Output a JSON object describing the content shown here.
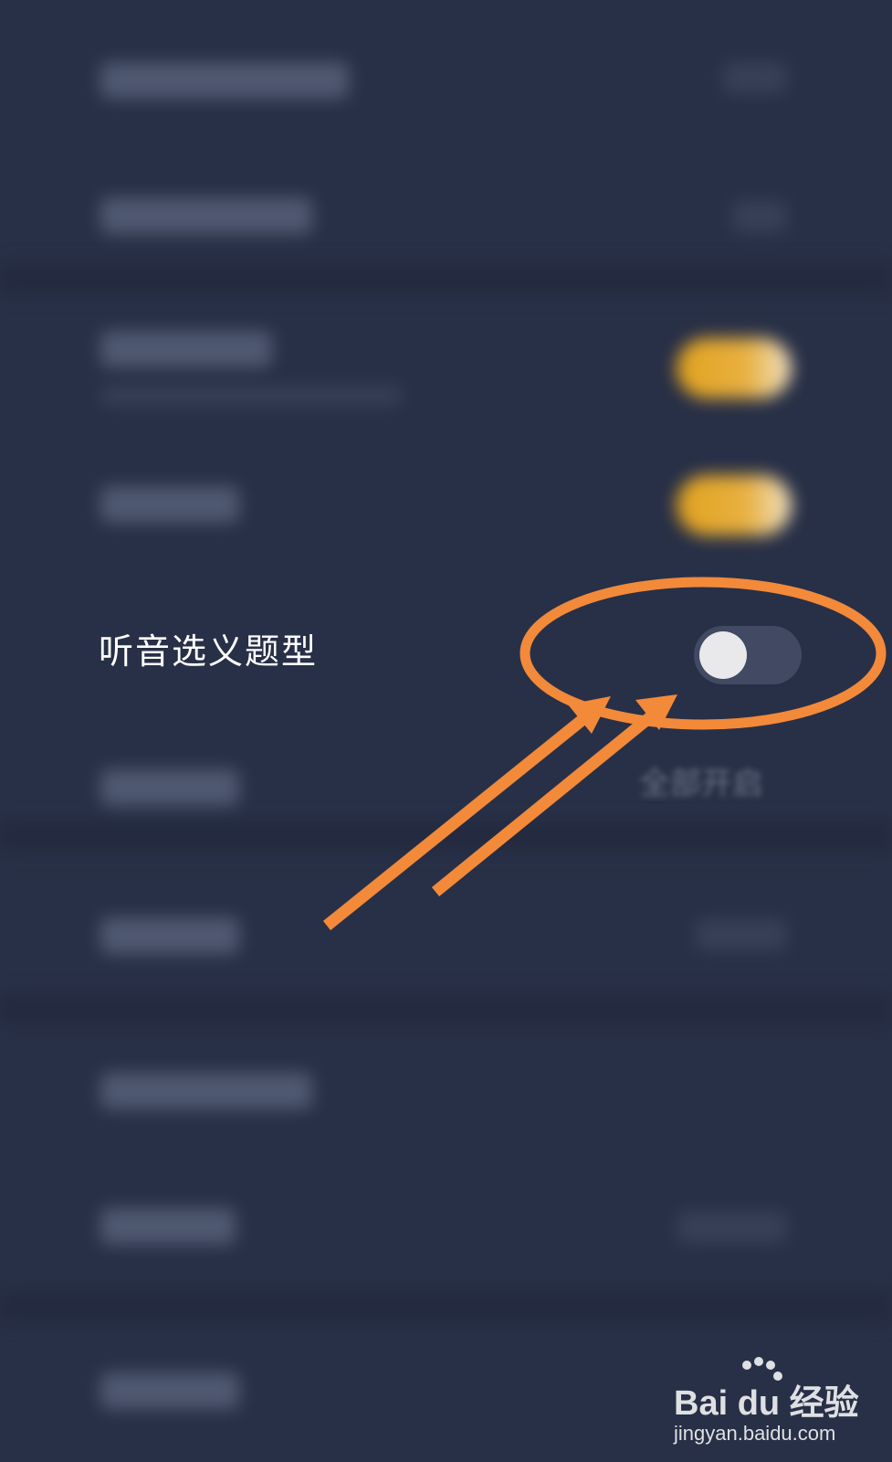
{
  "settings": {
    "focused_item": {
      "label": "听音选义题型",
      "toggle_on": false
    },
    "obscured_row_value": "全部开启",
    "toggle_on_color": "#E5A72A",
    "toggle_off_color": "#424A63"
  },
  "annotation": {
    "color": "#F28A3A",
    "shape": "ellipse-with-double-arrow"
  },
  "watermark": {
    "brand": "Bai du 经验",
    "url": "jingyan.baidu.com"
  }
}
